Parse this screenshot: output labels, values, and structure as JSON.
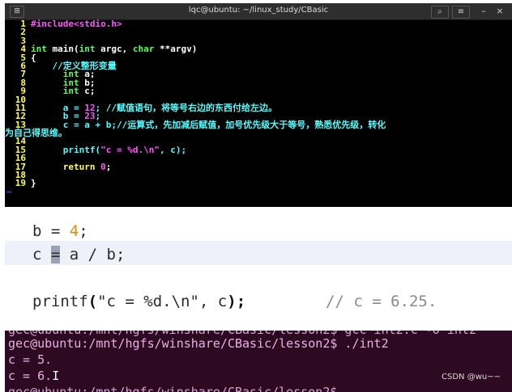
{
  "terminal": {
    "title": "lqc@ubuntu: ~/linux_study/CBasic",
    "new_tab_icon": "new-tab-icon",
    "search_icon": "search-icon",
    "menu_icon": "menu-icon",
    "minimize_symbol": "–",
    "close_symbol": "×"
  },
  "vim": {
    "line_numbers": [
      "1",
      "2",
      "3",
      "4",
      "5",
      "6",
      "7",
      "8",
      "9",
      "10",
      "11",
      "12",
      "13",
      "14",
      "15",
      "16",
      "17",
      "18",
      "19"
    ],
    "l1_pp": "#include",
    "l1_hdr": "<stdio.h>",
    "l4_type": "int",
    "l4_mid": " main(",
    "l4_type2": "int",
    "l4_arg1": " argc, ",
    "l4_type3": "char",
    "l4_arg2": " **argv)",
    "l5": "{",
    "l6": "    //定义整形变量",
    "l7_type": "int",
    "l7_var": " a;",
    "l8_type": "int",
    "l8_var": " b;",
    "l9_type": "int",
    "l9_var": " c;",
    "l11_code": "a = ",
    "l11_num": "12",
    "l11_cm": "; //赋值语句，将等号右边的东西付给左边。",
    "l12_code": "b = ",
    "l12_num": "23",
    "l12_end": ";",
    "l13_code": "c = a + b;",
    "l13_cm": "//运算式，先加减后赋值，加号优先级大于等号，熟悉优先级，转化",
    "l13_wrap": "为自己得思维。",
    "l15_fn": "printf(",
    "l15_str": "\"c = %d.\\n\"",
    "l15_end": ", c);",
    "l17_kw": "return",
    "l17_num": "0",
    "l17_end": ";",
    "l19": "}",
    "tilde": "~"
  },
  "zoom": {
    "line1_code": "b = ",
    "line1_num": "4",
    "line1_end": ";",
    "line2_a": "c ",
    "line2_cursor": "=",
    "line2_b": " a / b;",
    "line3_fn": "printf",
    "line3_paren": "(",
    "line3_str": "\"c = %d.\\n\", c",
    "line3_close": ");",
    "line3_comment": "// c = 6.25."
  },
  "output": {
    "line0": "gec@ubuntu:/mnt/hgfs/winshare/CBasic/lesson2$ gcc int2.c -o int2",
    "line1": "gec@ubuntu:/mnt/hgfs/winshare/CBasic/lesson2$ ./int2",
    "line2": "c = 5.",
    "line3": "c = 6.",
    "line3_cursor": "I",
    "line4": "gec@ubuntu:/mnt/hgfs/winshare/CBasic/lesson2$"
  },
  "watermark": "CSDN @wu~~",
  "colors": {
    "vim_linenumber": "#ffff55",
    "vim_type": "#55ff55",
    "vim_comment": "#55ffff",
    "vim_constant": "#ff55ff",
    "output_bg": "#2d0a22",
    "output_text": "#e8b2e0"
  }
}
